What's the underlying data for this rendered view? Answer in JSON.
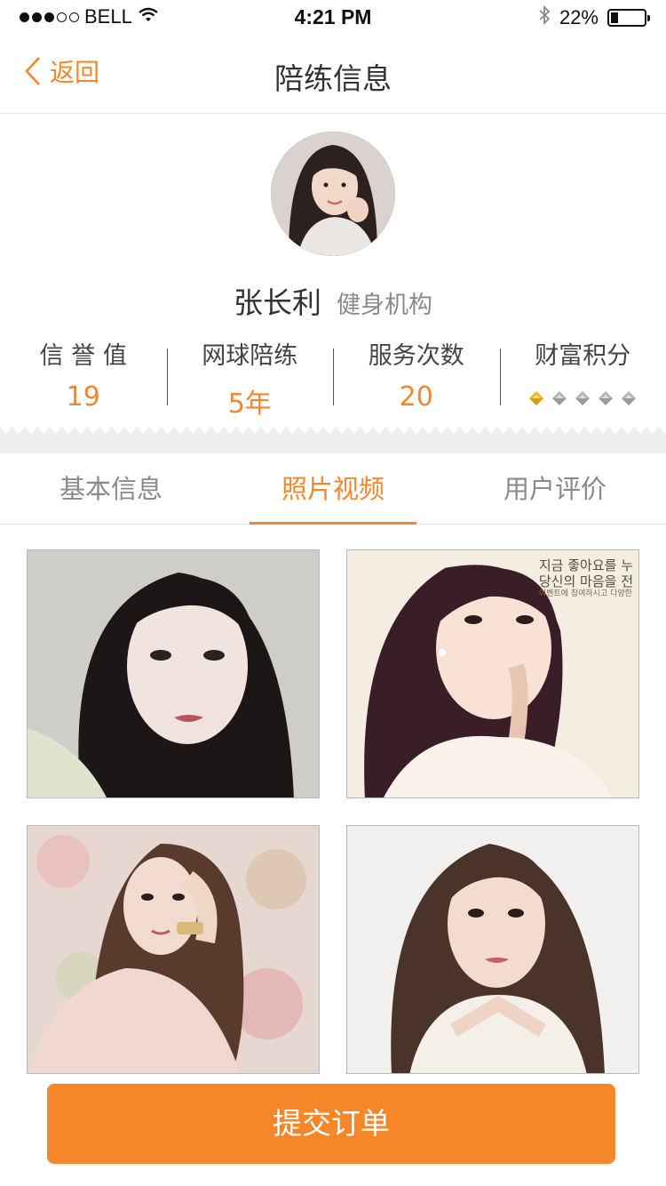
{
  "status_bar": {
    "carrier": "BELL",
    "time": "4:21 PM",
    "battery": "22%",
    "battery_level": 0.22,
    "icons": [
      "signal-dots",
      "wifi-icon",
      "bluetooth-icon",
      "battery-icon"
    ]
  },
  "nav": {
    "back_label": "返回",
    "title": "陪练信息"
  },
  "profile": {
    "name": "张长利",
    "org": "健身机构",
    "stats": [
      {
        "label": "信 誉 值",
        "value": "19"
      },
      {
        "label": "网球陪练",
        "value": "5年"
      },
      {
        "label": "服务次数",
        "value": "20"
      },
      {
        "label": "财富积分",
        "value": ""
      }
    ],
    "wealth_level": 1,
    "wealth_max": 5
  },
  "tabs": [
    {
      "label": "基本信息",
      "active": false
    },
    {
      "label": "照片视频",
      "active": true
    },
    {
      "label": "用户评价",
      "active": false
    }
  ],
  "photos": [
    {
      "name": "photo-1"
    },
    {
      "name": "photo-2",
      "overlay": [
        "지금 좋아요를 누",
        "당신의 마음을 전",
        "이벤트에 참여하시고 다양한"
      ]
    },
    {
      "name": "photo-3"
    },
    {
      "name": "photo-4"
    }
  ],
  "submit_label": "提交订单",
  "colors": {
    "accent": "#f5862a",
    "text": "#333333",
    "muted": "#8a8a8a",
    "diamond_inactive": "#b5b5b5",
    "diamond_active": "#f5b81c"
  }
}
